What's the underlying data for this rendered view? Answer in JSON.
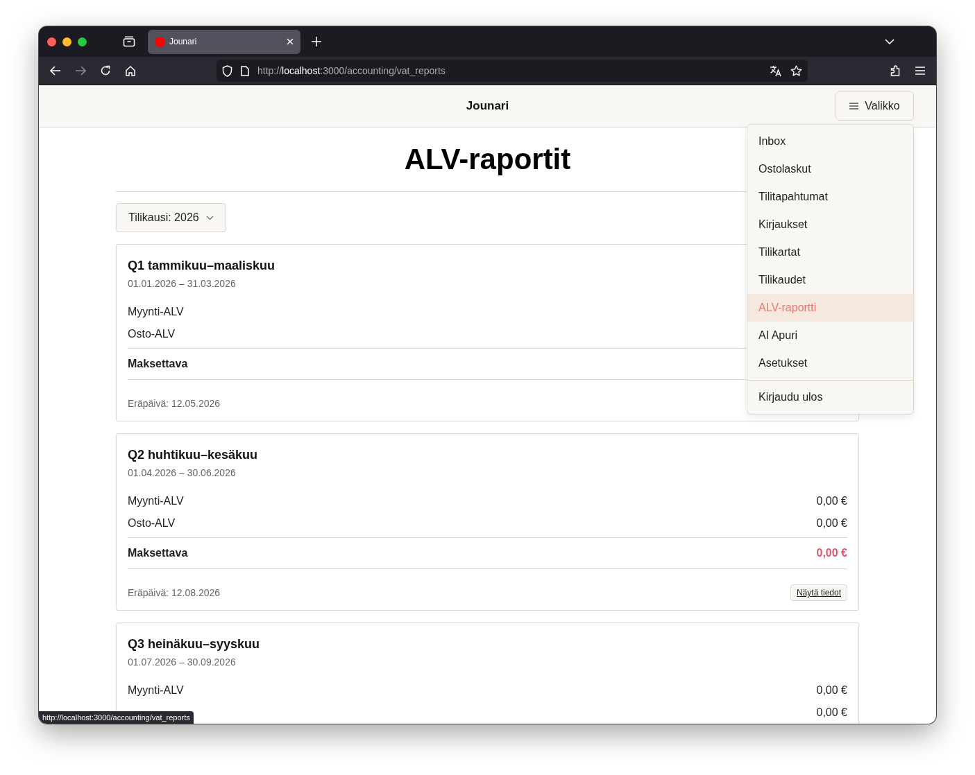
{
  "browser": {
    "tab_title": "Jounari",
    "url": "http://**localhost**:3000/accounting/vat_reports",
    "status_url": "http://localhost:3000/accounting/vat_reports"
  },
  "header": {
    "brand": "Jounari",
    "menu_button": "Valikko"
  },
  "menu": {
    "items": [
      {
        "label": "Inbox",
        "selected": false
      },
      {
        "label": "Ostolaskut",
        "selected": false
      },
      {
        "label": "Tilitapahtumat",
        "selected": false
      },
      {
        "label": "Kirjaukset",
        "selected": false
      },
      {
        "label": "Tilikartat",
        "selected": false
      },
      {
        "label": "Tilikaudet",
        "selected": false
      },
      {
        "label": "ALV-raportti",
        "selected": true
      },
      {
        "label": "AI Apuri",
        "selected": false
      },
      {
        "label": "Asetukset",
        "selected": false
      }
    ],
    "footer_items": [
      {
        "label": "Kirjaudu ulos",
        "selected": false
      }
    ]
  },
  "page": {
    "title": "ALV-raportit",
    "period_select": "Tilikausi: 2026"
  },
  "reports": [
    {
      "title": "Q1 tammikuu–maaliskuu",
      "dates": "01.01.2026 – 31.03.2026",
      "rows": [
        {
          "label": "Myynti-ALV"
        },
        {
          "label": "Osto-ALV"
        }
      ],
      "total": {
        "label": "Maksettava"
      },
      "due": "Eräpäivä: 12.05.2026"
    },
    {
      "title": "Q2 huhtikuu–kesäkuu",
      "dates": "01.04.2026 – 30.06.2026",
      "rows": [
        {
          "label": "Myynti-ALV",
          "amount": "0,00 €"
        },
        {
          "label": "Osto-ALV",
          "amount": "0,00 €"
        }
      ],
      "total": {
        "label": "Maksettava",
        "amount": "0,00 €"
      },
      "due": "Eräpäivä: 12.08.2026",
      "details_button": "Näytä tiedot"
    },
    {
      "title": "Q3 heinäkuu–syyskuu",
      "dates": "01.07.2026 – 30.09.2026",
      "rows": [
        {
          "label": "Myynti-ALV",
          "amount": "0,00 €"
        },
        {
          "amount": "0,00 €"
        }
      ]
    }
  ]
}
